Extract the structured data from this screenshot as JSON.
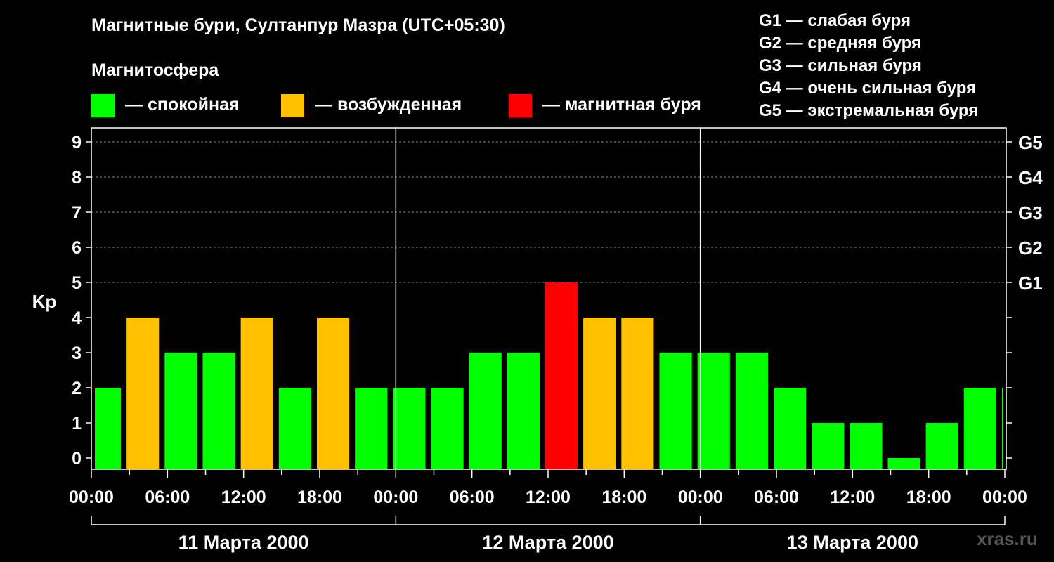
{
  "chart_data": {
    "type": "bar",
    "title": "Магнитные бури, Султанпур Мазра (UTC+05:30)",
    "subtitle": "Магнитосфера",
    "ylabel": "Kp",
    "ylim": [
      0,
      9
    ],
    "yticks": [
      0,
      1,
      2,
      3,
      4,
      5,
      6,
      7,
      8,
      9
    ],
    "right_ticks": [
      {
        "kp": 5,
        "label": "G1"
      },
      {
        "kp": 6,
        "label": "G2"
      },
      {
        "kp": 7,
        "label": "G3"
      },
      {
        "kp": 8,
        "label": "G4"
      },
      {
        "kp": 9,
        "label": "G5"
      }
    ],
    "grid": "dashed horizontal lines at Kp 5–9",
    "x_tick_labels": [
      "00:00",
      "06:00",
      "12:00",
      "18:00",
      "00:00",
      "06:00",
      "12:00",
      "18:00",
      "00:00",
      "06:00",
      "12:00",
      "18:00",
      "00:00"
    ],
    "days": [
      "11 Марта 2000",
      "12 Марта 2000",
      "13 Марта 2000"
    ],
    "legend": [
      {
        "label": "— спокойная",
        "color": "#00ff00"
      },
      {
        "label": "— возбужденная",
        "color": "#ffc000"
      },
      {
        "label": "— магнитная буря",
        "color": "#ff0000"
      }
    ],
    "g_scale": [
      "G1 — слабая буря",
      "G2 — средняя буря",
      "G3 — сильная буря",
      "G4 — очень сильная буря",
      "G5 — экстремальная буря"
    ],
    "colors": {
      "quiet": "#00ff00",
      "active": "#ffc000",
      "storm": "#ff0000"
    },
    "bars": [
      {
        "start": "2000-03-11 00:00",
        "end": "2000-03-11 02:30",
        "kp": 2
      },
      {
        "start": "2000-03-11 02:30",
        "end": "2000-03-11 05:30",
        "kp": 4
      },
      {
        "start": "2000-03-11 05:30",
        "end": "2000-03-11 08:30",
        "kp": 3
      },
      {
        "start": "2000-03-11 08:30",
        "end": "2000-03-11 11:30",
        "kp": 3
      },
      {
        "start": "2000-03-11 11:30",
        "end": "2000-03-11 14:30",
        "kp": 4
      },
      {
        "start": "2000-03-11 14:30",
        "end": "2000-03-11 17:30",
        "kp": 2
      },
      {
        "start": "2000-03-11 17:30",
        "end": "2000-03-11 20:30",
        "kp": 4
      },
      {
        "start": "2000-03-11 20:30",
        "end": "2000-03-11 23:30",
        "kp": 2
      },
      {
        "start": "2000-03-11 23:30",
        "end": "2000-03-12 02:30",
        "kp": 2
      },
      {
        "start": "2000-03-12 02:30",
        "end": "2000-03-12 05:30",
        "kp": 2
      },
      {
        "start": "2000-03-12 05:30",
        "end": "2000-03-12 08:30",
        "kp": 3
      },
      {
        "start": "2000-03-12 08:30",
        "end": "2000-03-12 11:30",
        "kp": 3
      },
      {
        "start": "2000-03-12 11:30",
        "end": "2000-03-12 14:30",
        "kp": 5
      },
      {
        "start": "2000-03-12 14:30",
        "end": "2000-03-12 17:30",
        "kp": 4
      },
      {
        "start": "2000-03-12 17:30",
        "end": "2000-03-12 20:30",
        "kp": 4
      },
      {
        "start": "2000-03-12 20:30",
        "end": "2000-03-12 23:30",
        "kp": 3
      },
      {
        "start": "2000-03-12 23:30",
        "end": "2000-03-13 02:30",
        "kp": 3
      },
      {
        "start": "2000-03-13 02:30",
        "end": "2000-03-13 05:30",
        "kp": 3
      },
      {
        "start": "2000-03-13 05:30",
        "end": "2000-03-13 08:30",
        "kp": 2
      },
      {
        "start": "2000-03-13 08:30",
        "end": "2000-03-13 11:30",
        "kp": 1
      },
      {
        "start": "2000-03-13 11:30",
        "end": "2000-03-13 14:30",
        "kp": 1
      },
      {
        "start": "2000-03-13 14:30",
        "end": "2000-03-13 17:30",
        "kp": 0
      },
      {
        "start": "2000-03-13 17:30",
        "end": "2000-03-13 20:30",
        "kp": 1
      },
      {
        "start": "2000-03-13 20:30",
        "end": "2000-03-13 23:30",
        "kp": 2
      },
      {
        "start": "2000-03-13 23:30",
        "end": "2000-03-14 00:00",
        "kp": 2
      }
    ]
  },
  "watermark": "xras.ru"
}
